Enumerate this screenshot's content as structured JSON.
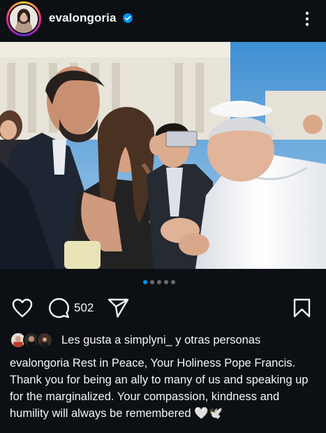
{
  "post": {
    "username": "evalongoria",
    "verified": true,
    "comment_count": "502",
    "likes_text": "Les gusta a simplyni_ y otras personas",
    "carousel": {
      "total": 5,
      "active": 0
    },
    "caption_user": "evalongoria",
    "caption_text": " Rest in Peace, Your Holiness Pope Francis. Thank you for being an ally to many of us and speaking up for the marginalized. Your compassion, kindness and humility will always be remembered 🤍🕊️"
  },
  "colors": {
    "background": "#0c1014",
    "accent_blue": "#0095f6",
    "text": "#f5f5f5"
  },
  "icons": [
    "verified-badge-icon",
    "more-options-icon",
    "heart-icon",
    "comment-icon",
    "share-icon",
    "bookmark-icon"
  ]
}
